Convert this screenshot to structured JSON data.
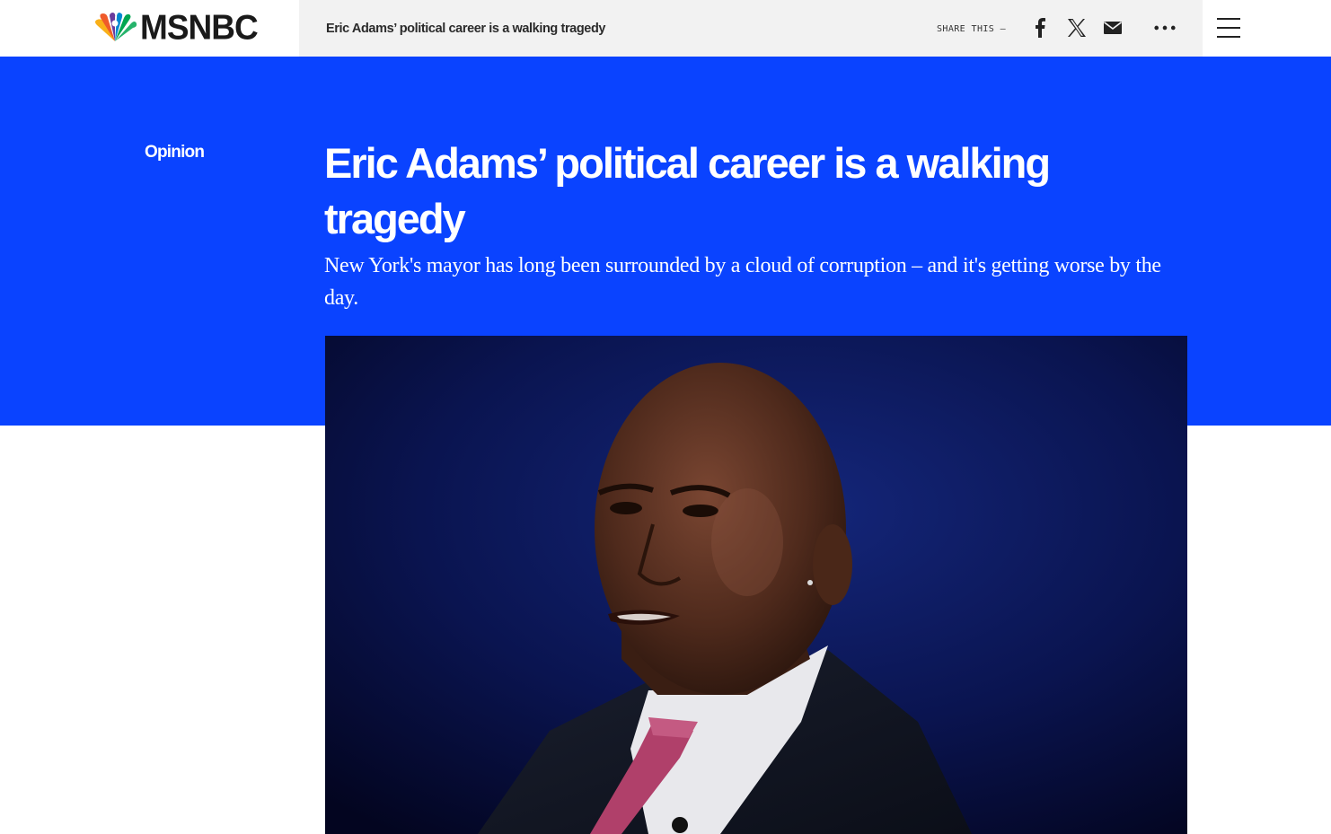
{
  "brand": {
    "wordmark": "MSNBC",
    "peacock_colors": [
      "#f9b019",
      "#ef5a2a",
      "#ee2a4d",
      "#6a3c9c",
      "#0089d0",
      "#00a651"
    ]
  },
  "share_bar": {
    "headline": "Eric Adams’ political career is a walking tragedy",
    "share_label": "SHARE THIS —",
    "icons": [
      "facebook-icon",
      "x-icon",
      "email-icon",
      "more-icon"
    ]
  },
  "menu": {
    "icon": "hamburger-menu-icon"
  },
  "article": {
    "section": "Opinion",
    "title": "Eric Adams’ political career is a walking tragedy",
    "dek": "New York's mayor has long been surrounded by a cloud of corruption – and it's getting worse by the day."
  },
  "colors": {
    "hero_background": "#0a43ff",
    "share_strip_background": "#f2f2f2",
    "text_on_hero": "#ffffff"
  }
}
